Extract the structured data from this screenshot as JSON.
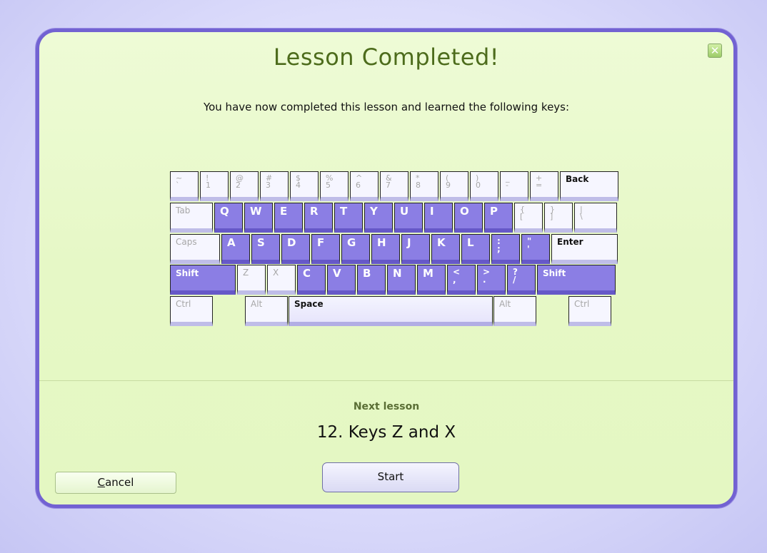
{
  "dialog": {
    "title": "Lesson Completed!",
    "close_glyph": "✕",
    "subtitle": "You have now completed this lesson and learned the following keys:",
    "next_label": "Next lesson",
    "next_title": "12. Keys Z and X",
    "start_label": "Start",
    "cancel_label": "Cancel",
    "cancel_mnemonic": "C"
  },
  "keyboard": {
    "rows": [
      [
        "~\n`",
        "!\n1",
        "@\n2",
        "#\n3",
        "$\n4",
        "%\n5",
        "^\n6",
        "&\n7",
        "*\n8",
        "(\n9",
        ")\n0",
        "_\n-",
        "+\n=",
        "Back"
      ],
      [
        "Tab",
        "Q",
        "W",
        "E",
        "R",
        "T",
        "Y",
        "U",
        "I",
        "O",
        "P",
        "{\n[",
        "}\n]",
        "|\n\\"
      ],
      [
        "Caps",
        "A",
        "S",
        "D",
        "F",
        "G",
        "H",
        "J",
        "K",
        "L",
        ":\n;",
        "\"\n'",
        "Enter"
      ],
      [
        "Shift",
        "Z",
        "X",
        "C",
        "V",
        "B",
        "N",
        "M",
        "<\n,",
        ">\n.",
        "?\n/",
        "Shift"
      ],
      [
        "Ctrl",
        "Alt",
        "Space",
        "Alt",
        "Ctrl"
      ]
    ],
    "learned_keys": [
      "Q",
      "W",
      "E",
      "R",
      "T",
      "Y",
      "U",
      "I",
      "O",
      "P",
      "A",
      "S",
      "D",
      "F",
      "G",
      "H",
      "J",
      "K",
      "L",
      ";",
      "'",
      "Shift",
      "C",
      "V",
      "B",
      "N",
      "M",
      ",",
      ".",
      "/"
    ]
  },
  "colors": {
    "accent": "#7262d2",
    "learned_key": "#8b7ee4",
    "title": "#4d6c1c",
    "dialog_bg": "#e6f8c6"
  }
}
